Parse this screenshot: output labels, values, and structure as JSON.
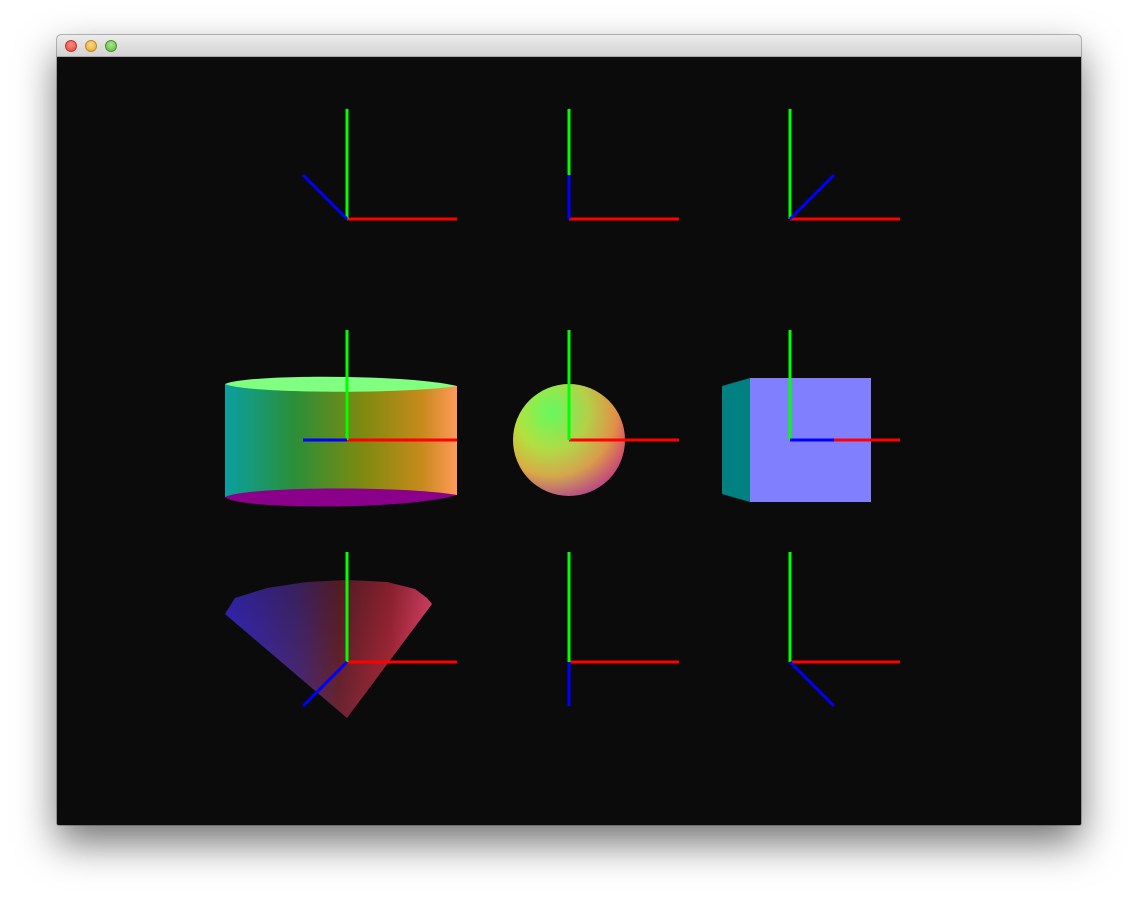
{
  "window": {
    "title": "",
    "controls": [
      "close-button",
      "minimize-button",
      "zoom-button"
    ]
  },
  "viewport": {
    "background": "#0b0b0b",
    "grid": {
      "rows": 3,
      "cols": 3
    },
    "axis_colors": {
      "x": "#ff0000",
      "y": "#00ff00",
      "z": "#0000ff"
    },
    "cells": [
      {
        "row": 0,
        "col": 0,
        "shape": "empty",
        "z_axis": "up-left"
      },
      {
        "row": 0,
        "col": 1,
        "shape": "empty",
        "z_axis": "up"
      },
      {
        "row": 0,
        "col": 2,
        "shape": "empty",
        "z_axis": "up-right"
      },
      {
        "row": 1,
        "col": 0,
        "shape": "cylinder",
        "z_axis": "left"
      },
      {
        "row": 1,
        "col": 1,
        "shape": "sphere",
        "z_axis": "none"
      },
      {
        "row": 1,
        "col": 2,
        "shape": "cube",
        "z_axis": "right",
        "cube_color": "#8080ff",
        "cube_side_color": "#008080"
      },
      {
        "row": 2,
        "col": 0,
        "shape": "cone",
        "z_axis": "down-left"
      },
      {
        "row": 2,
        "col": 1,
        "shape": "empty",
        "z_axis": "down"
      },
      {
        "row": 2,
        "col": 2,
        "shape": "empty",
        "z_axis": "down-right"
      }
    ]
  }
}
